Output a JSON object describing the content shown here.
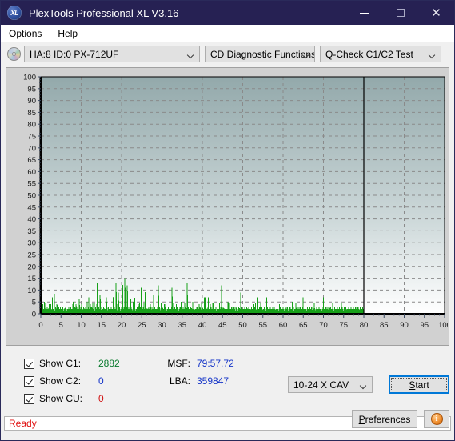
{
  "window": {
    "title": "PlexTools Professional XL V3.16",
    "icon": "XL",
    "controls": {
      "minimize": "minimize-icon",
      "maximize": "maximize-icon",
      "close": "close-icon"
    }
  },
  "menu": {
    "items": [
      {
        "acc": "O",
        "rest": "ptions"
      },
      {
        "acc": "H",
        "rest": "elp"
      }
    ]
  },
  "toolbar": {
    "drive": "HA:8 ID:0  PX-712UF",
    "function": "CD Diagnostic Functions",
    "test": "Q-Check C1/C2 Test"
  },
  "stats": {
    "c1_label": "Show C1:",
    "c1_value": "2882",
    "c2_label": "Show C2:",
    "c2_value": "0",
    "cu_label": "Show CU:",
    "cu_value": "0",
    "msf_label": "MSF:",
    "msf_value": "79:57.72",
    "lba_label": "LBA:",
    "lba_value": "359847",
    "speed": "10-24 X CAV",
    "start_acc": "S",
    "start_rest": "tart",
    "prefs_pre": "P",
    "prefs_rest": "references",
    "info_glyph": "i"
  },
  "statusbar": {
    "text": "Ready"
  },
  "colors": {
    "titlebar": "#262153",
    "c1": "#0a7a2e",
    "c2": "#1535c8",
    "cu": "#d01010",
    "status": "#e01010",
    "plot_top": "#93a9ab",
    "plot_bottom": "#ffffff",
    "accent": "#0078d7"
  },
  "chart_data": {
    "type": "bar",
    "title": "",
    "xlabel": "",
    "ylabel": "",
    "xlim": [
      0,
      100
    ],
    "ylim": [
      0,
      100
    ],
    "xticks": [
      0,
      5,
      10,
      15,
      20,
      25,
      30,
      35,
      40,
      45,
      50,
      55,
      60,
      65,
      70,
      75,
      80,
      85,
      90,
      95,
      100
    ],
    "yticks": [
      0,
      5,
      10,
      15,
      20,
      25,
      30,
      35,
      40,
      45,
      50,
      55,
      60,
      65,
      70,
      75,
      80,
      85,
      90,
      95,
      100
    ],
    "grid": true,
    "legend": null,
    "annotations": [
      {
        "type": "vline",
        "x": 80,
        "color": "#000000",
        "label": "end-of-data marker"
      }
    ],
    "series": [
      {
        "name": "C1",
        "color": "#17a019",
        "data_end_x": 80,
        "x_step": 0.16,
        "values": [
          1,
          3,
          2,
          1,
          4,
          2,
          1,
          2,
          5,
          3,
          2,
          12,
          2,
          1,
          3,
          2,
          1,
          2,
          4,
          3,
          2,
          1,
          4,
          2,
          1,
          3,
          1,
          2,
          1,
          15,
          2,
          1,
          3,
          2,
          1,
          4,
          2,
          1,
          2,
          3,
          1,
          2,
          1,
          3,
          2,
          1,
          2,
          1,
          3,
          2,
          1,
          2,
          1,
          2,
          3,
          1,
          2,
          1,
          2,
          1,
          2,
          3,
          1,
          2,
          1,
          3,
          2,
          1,
          2,
          1,
          4,
          5,
          2,
          1,
          3,
          1,
          2,
          4,
          2,
          1,
          3,
          2,
          1,
          2,
          6,
          2,
          1,
          3,
          2,
          4,
          1,
          2,
          1,
          3,
          2,
          1,
          2,
          1,
          3,
          2,
          1,
          5,
          2,
          1,
          3,
          2,
          1,
          2,
          4,
          1,
          2,
          3,
          1,
          2,
          1,
          2,
          5,
          2,
          1,
          3,
          2,
          1,
          4,
          13,
          2,
          1,
          3,
          2,
          1,
          8,
          2,
          1,
          3,
          10,
          2,
          1,
          2,
          3,
          1,
          2,
          1,
          2,
          3,
          1,
          5,
          2,
          1,
          3,
          2,
          1,
          2,
          1,
          2,
          3,
          1,
          2,
          1,
          2,
          7,
          2,
          3,
          1,
          2,
          1,
          13,
          2,
          1,
          4,
          2,
          9,
          1,
          3,
          2,
          1,
          2,
          1,
          3,
          2,
          12,
          1,
          2,
          3,
          1,
          15,
          2,
          1,
          2,
          3,
          12,
          1,
          2,
          1,
          3,
          2,
          1,
          2,
          6,
          3,
          1,
          2,
          1,
          5,
          2,
          1,
          3,
          2,
          1,
          2,
          1,
          2,
          3,
          1,
          2,
          4,
          1,
          2,
          1,
          3,
          2,
          11,
          1,
          2,
          1,
          3,
          2,
          1,
          2,
          4,
          1,
          3,
          2,
          1,
          2,
          1,
          2,
          3,
          1,
          2,
          1,
          4,
          2,
          1,
          3,
          2,
          1,
          2,
          8,
          1,
          3,
          2,
          1,
          2,
          1,
          2,
          3,
          1,
          12,
          2,
          1,
          3,
          2,
          1,
          2,
          1,
          2,
          3,
          1,
          2,
          1,
          4,
          2,
          1,
          3,
          2,
          1,
          2,
          1,
          2,
          3,
          1,
          2,
          9,
          1,
          2,
          1,
          3,
          11,
          2,
          1,
          2,
          1,
          3,
          2,
          1,
          2,
          4,
          1,
          3,
          2,
          1,
          2,
          1,
          2,
          3,
          1,
          2,
          5,
          1,
          2,
          1,
          3,
          2,
          1,
          2,
          1,
          3,
          2,
          1,
          2,
          13,
          1,
          3,
          2,
          1,
          2,
          1,
          2,
          3,
          1,
          2,
          1,
          5,
          2,
          1,
          3,
          2,
          1,
          2,
          1,
          2,
          3,
          1,
          2,
          1,
          2,
          4,
          1,
          3,
          2,
          1,
          2,
          1,
          3,
          2,
          1,
          2,
          7,
          1,
          3,
          2,
          1,
          2,
          1,
          2,
          3,
          1,
          2,
          1,
          2,
          4,
          1,
          3,
          2,
          1,
          2,
          1,
          2,
          3,
          1,
          2,
          1,
          2,
          3,
          1,
          2,
          1,
          3,
          2,
          1,
          2,
          1,
          2,
          3,
          1,
          12,
          2,
          1,
          3,
          2,
          1,
          2,
          1,
          2,
          3,
          1,
          2,
          1,
          2,
          5,
          1,
          3,
          2,
          1,
          2,
          1,
          2,
          3,
          1,
          2,
          1,
          2,
          3,
          1,
          2,
          1,
          3,
          2,
          1,
          2,
          1,
          2,
          3,
          1,
          2,
          1,
          2,
          9,
          1,
          3,
          2,
          1,
          2,
          1,
          2,
          3,
          1,
          2,
          1,
          2,
          3,
          1,
          2,
          1,
          3,
          2,
          1,
          2,
          1,
          2,
          3,
          1,
          2,
          1,
          2,
          4,
          1,
          3,
          2,
          1,
          2,
          1,
          2,
          3,
          1,
          2,
          1,
          2,
          3,
          1,
          2,
          1,
          3,
          2,
          1,
          2,
          1,
          2,
          3,
          1,
          2,
          1,
          2,
          7,
          1,
          3,
          2,
          1,
          2,
          1,
          2,
          3,
          1,
          2,
          1,
          2,
          3,
          1,
          2,
          1,
          3,
          2,
          1,
          2,
          1,
          2,
          3,
          1,
          2,
          1,
          2,
          4,
          1,
          3,
          2,
          1,
          2,
          1,
          2,
          3,
          1,
          2,
          1,
          2,
          3,
          1,
          2,
          1,
          3,
          2,
          1,
          2,
          1,
          2,
          3,
          1,
          2,
          1,
          2,
          5,
          1,
          3,
          2,
          1,
          2,
          1,
          2,
          3,
          1,
          2,
          1,
          2,
          3,
          1,
          2,
          1,
          3,
          2,
          1,
          2,
          1,
          2,
          3,
          1,
          2,
          1,
          2,
          3,
          1,
          2,
          1,
          2,
          3,
          1,
          2,
          1,
          2,
          3,
          1,
          2,
          1,
          3,
          2,
          1,
          2,
          1,
          2,
          3,
          1,
          2,
          1,
          2,
          3,
          1,
          2,
          1,
          2,
          3,
          1,
          2,
          1,
          2,
          3,
          1,
          2,
          1,
          3,
          2,
          1,
          2,
          1,
          2,
          3,
          1,
          2,
          1,
          2,
          3,
          1,
          2,
          1,
          2,
          3,
          1,
          2,
          1,
          2,
          3,
          1,
          2,
          1,
          3,
          2,
          1,
          2,
          1,
          2,
          3,
          1,
          2,
          1,
          2,
          3,
          1,
          2,
          1,
          2,
          3,
          1,
          2,
          1,
          2,
          3,
          1,
          2,
          1,
          3,
          2,
          1,
          2,
          1,
          2,
          3,
          1,
          2,
          1,
          2,
          3,
          1,
          2,
          1,
          2,
          3,
          1,
          2,
          1,
          2,
          3,
          1,
          2,
          1,
          2,
          3,
          1,
          2,
          1,
          2,
          3,
          1,
          2,
          1,
          2,
          3,
          1,
          2
        ],
        "max_observed": 16,
        "note": "C1 error rate trace, dense vertical spikes mostly under 16, concentrated 0-80"
      }
    ]
  }
}
